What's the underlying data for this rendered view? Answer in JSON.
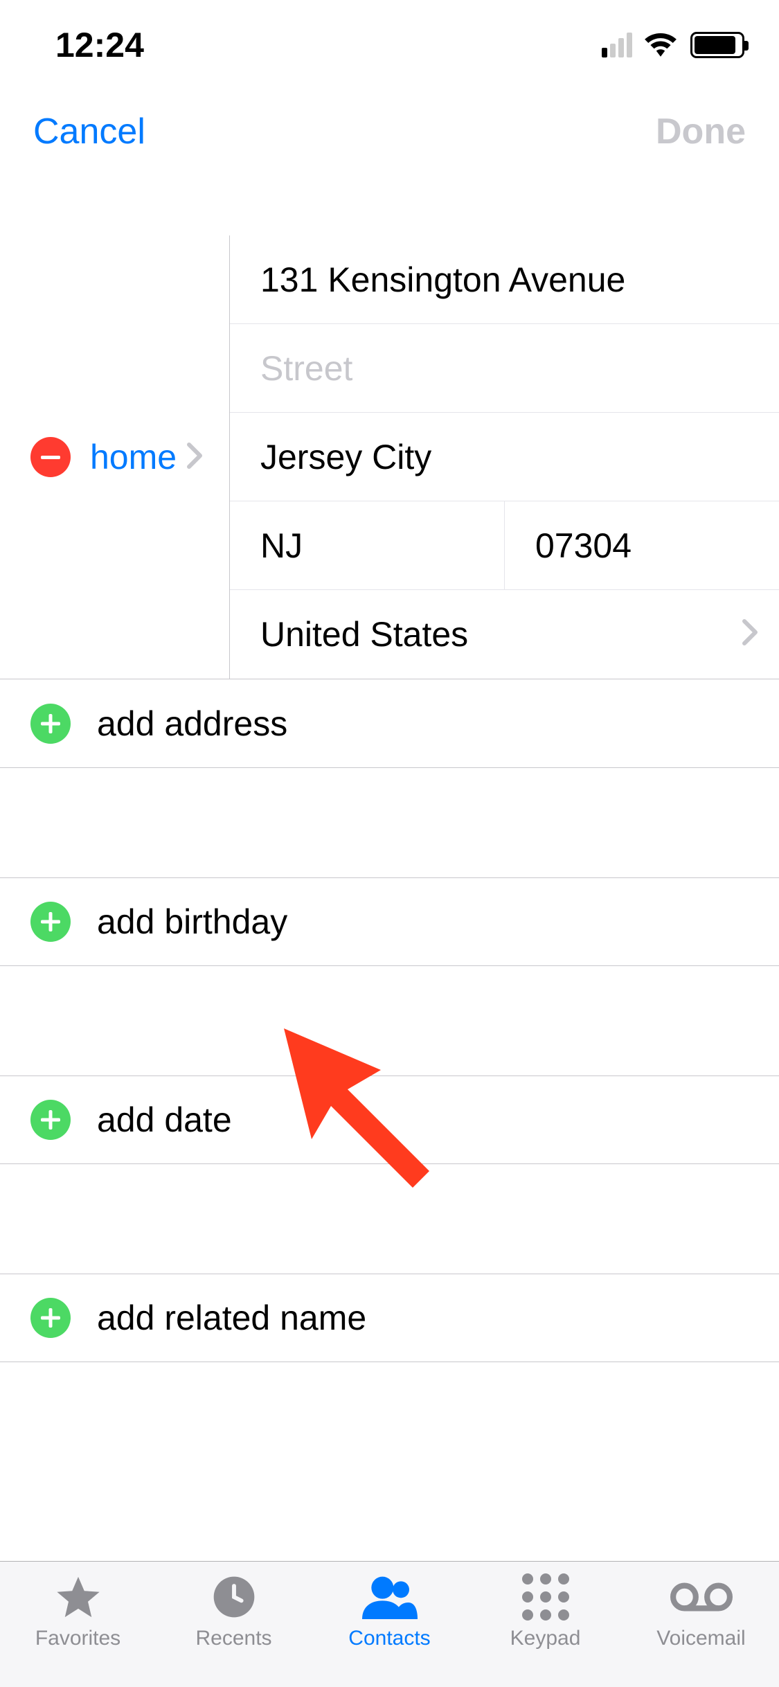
{
  "status": {
    "time": "12:24"
  },
  "nav": {
    "cancel": "Cancel",
    "done": "Done"
  },
  "address": {
    "type_label": "home",
    "street1": "131 Kensington Avenue",
    "street2_placeholder": "Street",
    "city": "Jersey City",
    "state": "NJ",
    "zip": "07304",
    "country": "United States"
  },
  "add_rows": {
    "address": "add address",
    "birthday": "add birthday",
    "date": "add date",
    "related": "add related name"
  },
  "tabs": {
    "favorites": "Favorites",
    "recents": "Recents",
    "contacts": "Contacts",
    "keypad": "Keypad",
    "voicemail": "Voicemail"
  }
}
